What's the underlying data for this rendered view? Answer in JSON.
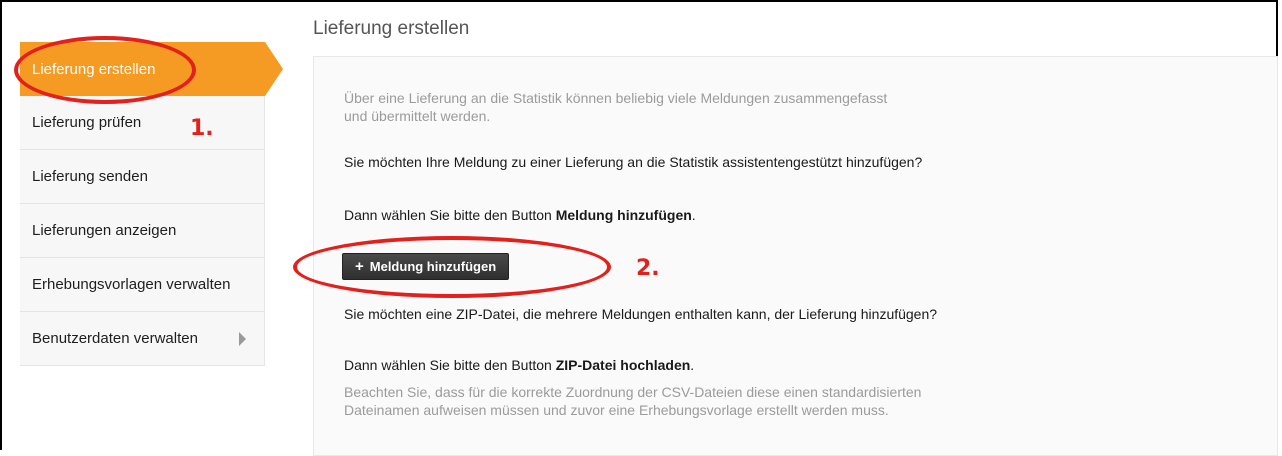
{
  "sidebar": {
    "items": [
      {
        "label": "Lieferung erstellen",
        "active": true
      },
      {
        "label": "Lieferung prüfen"
      },
      {
        "label": "Lieferung senden"
      },
      {
        "label": "Lieferungen anzeigen"
      },
      {
        "label": "Erhebungsvorlagen verwalten"
      },
      {
        "label": "Benutzerdaten verwalten",
        "has_submenu": true
      }
    ]
  },
  "main": {
    "title": "Lieferung erstellen",
    "intro": "Über eine Lieferung an die Statistik können beliebig viele Meldungen zusammengefasst und übermittelt werden.",
    "q1": "Sie möchten Ihre Meldung zu einer Lieferung an die Statistik assistentengestützt hinzufügen?",
    "hint1_prefix": "Dann wählen Sie bitte den Button ",
    "hint1_bold": "Meldung hinzufügen",
    "hint1_suffix": ".",
    "add_button_label": "Meldung hinzufügen",
    "q2": "Sie möchten eine ZIP-Datei, die mehrere Meldungen enthalten kann, der Lieferung hinzufügen?",
    "hint2_prefix": "Dann wählen Sie bitte den Button ",
    "hint2_bold": "ZIP-Datei hochladen",
    "hint2_suffix": ".",
    "note": "Beachten Sie, dass für die korrekte Zuordnung der CSV-Dateien diese einen standardisierten Dateinamen aufweisen müssen und zuvor eine Erhebungsvorlage erstellt werden muss."
  },
  "annotations": {
    "step1": "1.",
    "step2": "2.",
    "color": "#e3201b"
  },
  "colors": {
    "accent": "#f59a23"
  }
}
